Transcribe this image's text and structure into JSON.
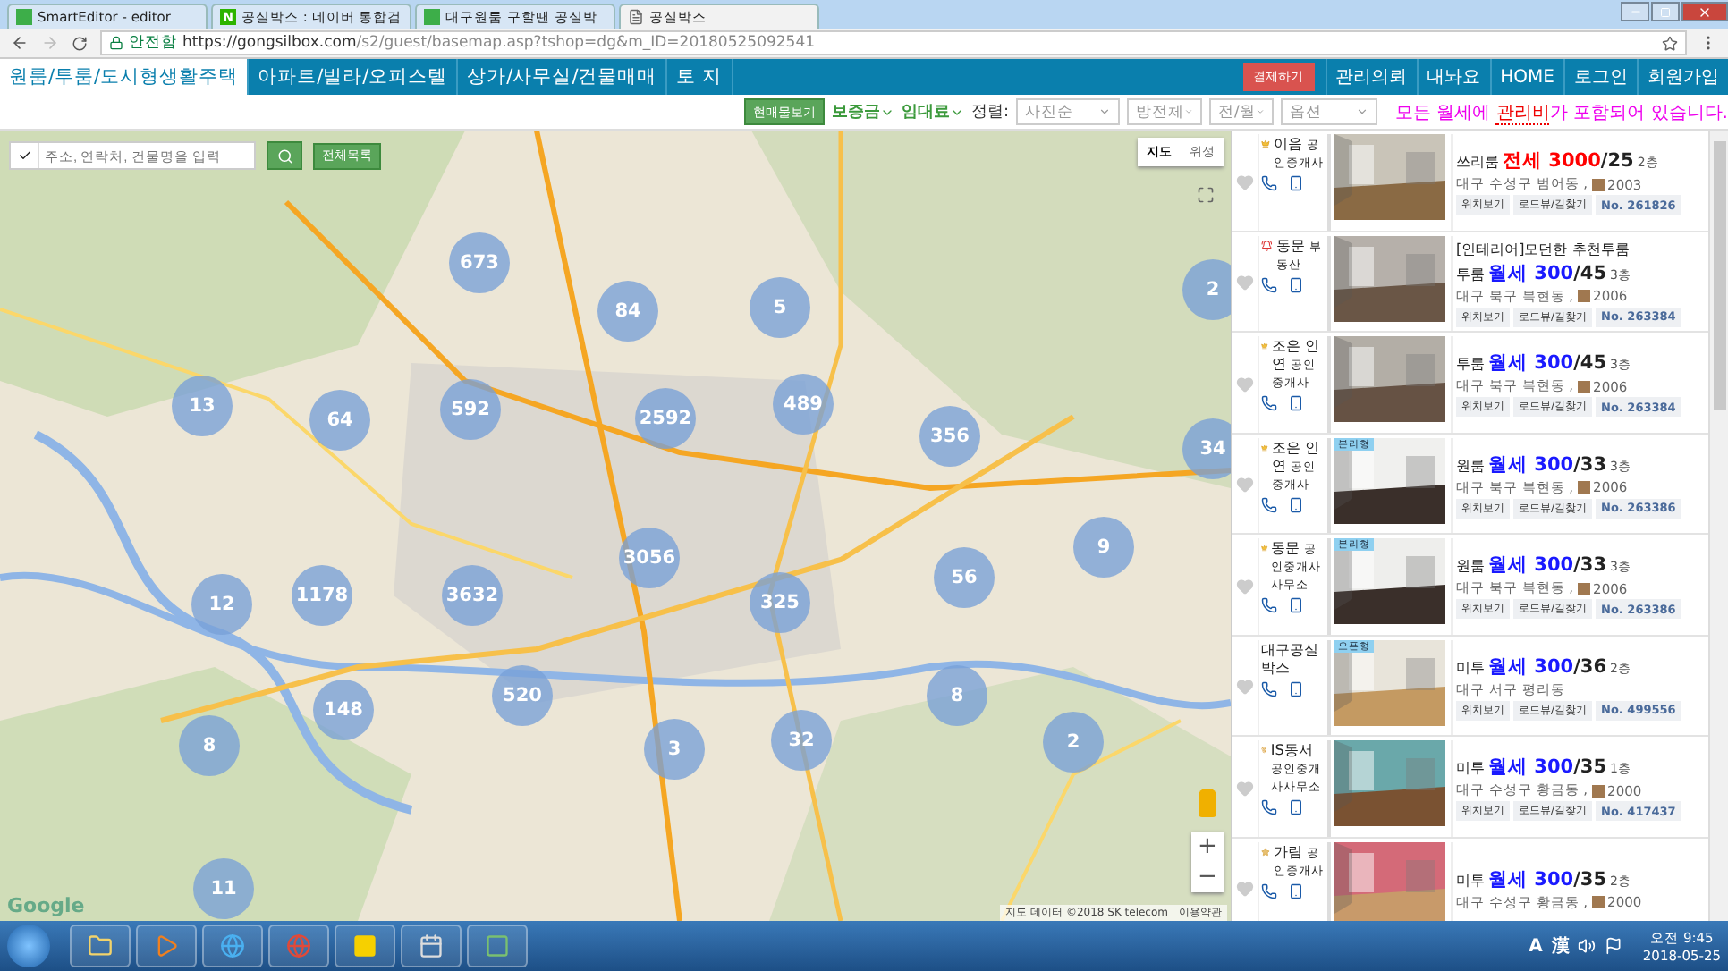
{
  "browser": {
    "tabs": [
      {
        "title": "SmartEditor - editor",
        "selected": false,
        "kind": "editor"
      },
      {
        "title": "공실박스 : 네이버 통합검",
        "selected": false,
        "kind": "naver",
        "icon_text": "N"
      },
      {
        "title": "대구원룸 구할땐 공실박",
        "selected": false,
        "kind": "editor"
      },
      {
        "title": "공실박스",
        "selected": true,
        "kind": "page"
      }
    ],
    "security": "안전함",
    "url_host": "https://gongsilbox.com",
    "url_path": "/s2/guest/basemap.asp?tshop=dg&m_ID=20180525092541"
  },
  "nav": {
    "categories": [
      {
        "label": "원룸/투룸/도시형생활주택",
        "selected": true
      },
      {
        "label": "아파트/빌라/오피스텔",
        "selected": false
      },
      {
        "label": "상가/사무실/건물매매",
        "selected": false
      },
      {
        "label": "토 지",
        "selected": false
      }
    ],
    "pay_button": "결제하기",
    "links": [
      "관리의뢰",
      "내놔요",
      "HOME",
      "로그인",
      "회원가입"
    ]
  },
  "filters": {
    "view_button": "현매물보기",
    "dropdowns": [
      "보증금",
      "임대료"
    ],
    "sort_label": "정렬:",
    "selects": [
      "사진순",
      "방전체",
      "전/월",
      "옵션"
    ],
    "notice": {
      "before": "모든 월세에 ",
      "highlight": "관리비",
      "after": "가 포함되어 있습니다."
    }
  },
  "map": {
    "search_placeholder": "주소, 연락처, 건물명을 입력",
    "list_button": "전체목록",
    "map_types": [
      {
        "label": "지도",
        "selected": true
      },
      {
        "label": "위성",
        "selected": false
      }
    ],
    "clusters": [
      "673",
      "84",
      "5",
      "2",
      "13",
      "64",
      "592",
      "2592",
      "489",
      "356",
      "34",
      "1178",
      "12",
      "3632",
      "3056",
      "325",
      "56",
      "9",
      "520",
      "148",
      "8",
      "3",
      "32",
      "8",
      "2",
      "11"
    ],
    "logo": "Google",
    "attribution": "지도 데이터 ©2018 SK telecom",
    "terms": "이용약관",
    "zoom_in": "+",
    "zoom_out": "−"
  },
  "listings": [
    {
      "agent": "이음",
      "agent_sub": "공인중개사",
      "kind": "crown",
      "type": "쓰리룸",
      "deal": "전세",
      "color": "#ff0000",
      "deposit": "3000",
      "rent": "/25",
      "floor": "2층",
      "address": "대구 수성구 범어동 ,",
      "year": "2003",
      "buttons": [
        "위치보기",
        "로드뷰/길찾기"
      ],
      "number": "No. 261826"
    },
    {
      "agent": "동문",
      "agent_sub": "부동산",
      "kind": "bell",
      "title": "[인테리어]모던한 추천투룸",
      "type": "투룸",
      "deal": "월세",
      "color": "#1a1aff",
      "deposit": "300",
      "rent": "/45",
      "floor": "3층",
      "address": "대구 북구 복현동 ,",
      "year": "2006",
      "buttons": [
        "위치보기",
        "로드뷰/길찾기"
      ],
      "number": "No. 263384"
    },
    {
      "agent": "조은 인연",
      "agent_sub": "공인중개사",
      "kind": "crown",
      "type": "투룸",
      "deal": "월세",
      "color": "#1a1aff",
      "deposit": "300",
      "rent": "/45",
      "floor": "3층",
      "address": "대구 북구 복현동 ,",
      "year": "2006",
      "buttons": [
        "위치보기",
        "로드뷰/길찾기"
      ],
      "number": "No. 263384"
    },
    {
      "agent": "조은 인연",
      "agent_sub": "공인중개사",
      "kind": "crown",
      "tag": "분리형",
      "type": "원룸",
      "deal": "월세",
      "color": "#1a1aff",
      "deposit": "300",
      "rent": "/33",
      "floor": "3층",
      "address": "대구 북구 복현동 ,",
      "year": "2006",
      "buttons": [
        "위치보기",
        "로드뷰/길찾기"
      ],
      "number": "No. 263386"
    },
    {
      "agent": "동문",
      "agent_sub": "공인중개사사무소",
      "kind": "crown",
      "tag": "분리형",
      "type": "원룸",
      "deal": "월세",
      "color": "#1a1aff",
      "deposit": "300",
      "rent": "/33",
      "floor": "3층",
      "address": "대구 북구 복현동 ,",
      "year": "2006",
      "buttons": [
        "위치보기",
        "로드뷰/길찾기"
      ],
      "number": "No. 263386"
    },
    {
      "agent": "대구공실박스",
      "kind": "plain",
      "tag": "오픈형",
      "type": "미투",
      "deal": "월세",
      "color": "#1a1aff",
      "deposit": "300",
      "rent": "/36",
      "floor": "2층",
      "address": "대구 서구 평리동",
      "buttons": [
        "위치보기",
        "로드뷰/길찾기"
      ],
      "number": "No. 499556"
    },
    {
      "agent": "IS동서",
      "agent_sub": "공인중개사사무소",
      "kind": "medal",
      "type": "미투",
      "deal": "월세",
      "color": "#1a1aff",
      "deposit": "300",
      "rent": "/35",
      "floor": "1층",
      "address": "대구 수성구 황금동 ,",
      "year": "2000",
      "buttons": [
        "위치보기",
        "로드뷰/길찾기"
      ],
      "number": "No. 417437"
    },
    {
      "agent": "가림",
      "agent_sub": "공인중개사",
      "kind": "star",
      "type": "미투",
      "deal": "월세",
      "color": "#1a1aff",
      "deposit": "300",
      "rent": "/35",
      "floor": "2층",
      "address": "대구 수성구 황금동 ,",
      "year": "2000"
    }
  ],
  "taskbar": {
    "tray": [
      "A",
      "漢"
    ],
    "time": "오전 9:45",
    "date": "2018-05-25"
  }
}
